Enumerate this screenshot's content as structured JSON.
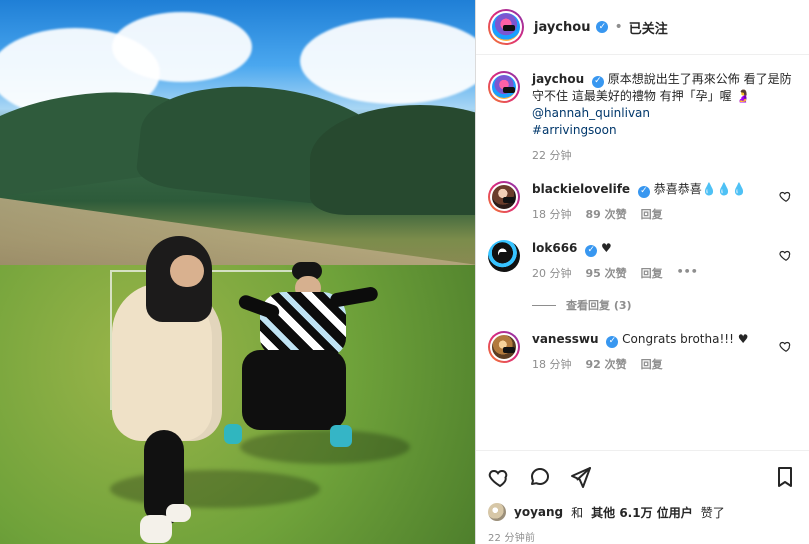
{
  "post": {
    "author": "jaychou",
    "follow_status": "已关注",
    "caption": "原本想說出生了再來公佈 看了是防守不住 這最美好的禮物 有押「孕」喔",
    "caption_emoji": "🤰",
    "caption_mention": "@hannah_quinlivan",
    "caption_hashtag": "#arrivingsoon",
    "caption_time": "22 分钟",
    "posted_time": "22 分钟前"
  },
  "comments": [
    {
      "username": "blackielovelife",
      "text": "恭喜恭喜💧💧💧",
      "time": "18 分钟",
      "likes": "89 次赞",
      "reply": "回复"
    },
    {
      "username": "lok666",
      "text": "♥",
      "time": "20 分钟",
      "likes": "95 次赞",
      "reply": "回复",
      "more": "•••",
      "view_replies": "查看回复 (3)"
    },
    {
      "username": "vanesswu",
      "text": "Congrats brotha!!! ♥",
      "time": "18 分钟",
      "likes": "92 次赞",
      "reply": "回复"
    }
  ],
  "likes_line": {
    "name": "yoyang",
    "and": "和",
    "others": "其他 6.1万 位用户",
    "liked": "赞了"
  },
  "icons": {
    "like": "heart-icon",
    "comment": "comment-icon",
    "share": "share-icon",
    "save": "bookmark-icon"
  },
  "colors": {
    "verified": "#3897f0",
    "text": "#262626",
    "muted": "#8e8e8e",
    "link": "#00376b"
  }
}
